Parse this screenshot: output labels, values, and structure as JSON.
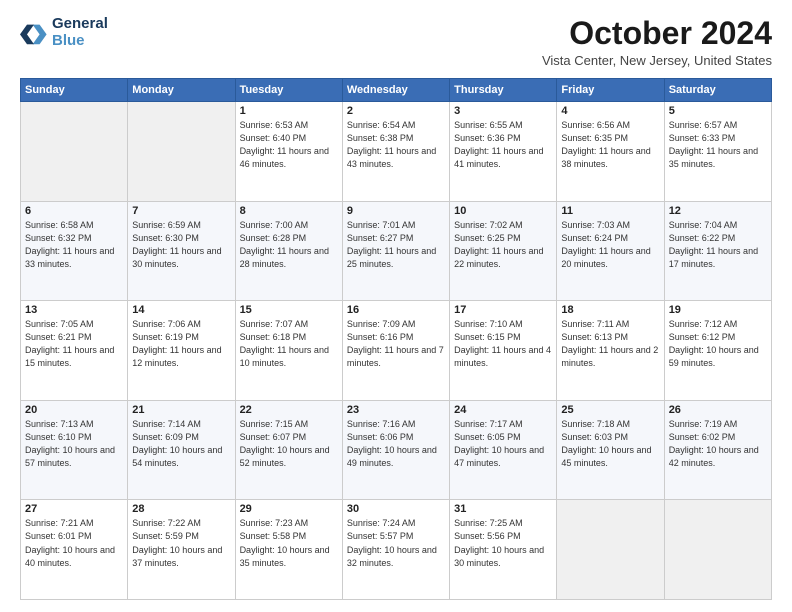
{
  "logo": {
    "line1": "General",
    "line2": "Blue"
  },
  "title": "October 2024",
  "location": "Vista Center, New Jersey, United States",
  "weekdays": [
    "Sunday",
    "Monday",
    "Tuesday",
    "Wednesday",
    "Thursday",
    "Friday",
    "Saturday"
  ],
  "weeks": [
    [
      {
        "day": "",
        "info": ""
      },
      {
        "day": "",
        "info": ""
      },
      {
        "day": "1",
        "info": "Sunrise: 6:53 AM\nSunset: 6:40 PM\nDaylight: 11 hours and 46 minutes."
      },
      {
        "day": "2",
        "info": "Sunrise: 6:54 AM\nSunset: 6:38 PM\nDaylight: 11 hours and 43 minutes."
      },
      {
        "day": "3",
        "info": "Sunrise: 6:55 AM\nSunset: 6:36 PM\nDaylight: 11 hours and 41 minutes."
      },
      {
        "day": "4",
        "info": "Sunrise: 6:56 AM\nSunset: 6:35 PM\nDaylight: 11 hours and 38 minutes."
      },
      {
        "day": "5",
        "info": "Sunrise: 6:57 AM\nSunset: 6:33 PM\nDaylight: 11 hours and 35 minutes."
      }
    ],
    [
      {
        "day": "6",
        "info": "Sunrise: 6:58 AM\nSunset: 6:32 PM\nDaylight: 11 hours and 33 minutes."
      },
      {
        "day": "7",
        "info": "Sunrise: 6:59 AM\nSunset: 6:30 PM\nDaylight: 11 hours and 30 minutes."
      },
      {
        "day": "8",
        "info": "Sunrise: 7:00 AM\nSunset: 6:28 PM\nDaylight: 11 hours and 28 minutes."
      },
      {
        "day": "9",
        "info": "Sunrise: 7:01 AM\nSunset: 6:27 PM\nDaylight: 11 hours and 25 minutes."
      },
      {
        "day": "10",
        "info": "Sunrise: 7:02 AM\nSunset: 6:25 PM\nDaylight: 11 hours and 22 minutes."
      },
      {
        "day": "11",
        "info": "Sunrise: 7:03 AM\nSunset: 6:24 PM\nDaylight: 11 hours and 20 minutes."
      },
      {
        "day": "12",
        "info": "Sunrise: 7:04 AM\nSunset: 6:22 PM\nDaylight: 11 hours and 17 minutes."
      }
    ],
    [
      {
        "day": "13",
        "info": "Sunrise: 7:05 AM\nSunset: 6:21 PM\nDaylight: 11 hours and 15 minutes."
      },
      {
        "day": "14",
        "info": "Sunrise: 7:06 AM\nSunset: 6:19 PM\nDaylight: 11 hours and 12 minutes."
      },
      {
        "day": "15",
        "info": "Sunrise: 7:07 AM\nSunset: 6:18 PM\nDaylight: 11 hours and 10 minutes."
      },
      {
        "day": "16",
        "info": "Sunrise: 7:09 AM\nSunset: 6:16 PM\nDaylight: 11 hours and 7 minutes."
      },
      {
        "day": "17",
        "info": "Sunrise: 7:10 AM\nSunset: 6:15 PM\nDaylight: 11 hours and 4 minutes."
      },
      {
        "day": "18",
        "info": "Sunrise: 7:11 AM\nSunset: 6:13 PM\nDaylight: 11 hours and 2 minutes."
      },
      {
        "day": "19",
        "info": "Sunrise: 7:12 AM\nSunset: 6:12 PM\nDaylight: 10 hours and 59 minutes."
      }
    ],
    [
      {
        "day": "20",
        "info": "Sunrise: 7:13 AM\nSunset: 6:10 PM\nDaylight: 10 hours and 57 minutes."
      },
      {
        "day": "21",
        "info": "Sunrise: 7:14 AM\nSunset: 6:09 PM\nDaylight: 10 hours and 54 minutes."
      },
      {
        "day": "22",
        "info": "Sunrise: 7:15 AM\nSunset: 6:07 PM\nDaylight: 10 hours and 52 minutes."
      },
      {
        "day": "23",
        "info": "Sunrise: 7:16 AM\nSunset: 6:06 PM\nDaylight: 10 hours and 49 minutes."
      },
      {
        "day": "24",
        "info": "Sunrise: 7:17 AM\nSunset: 6:05 PM\nDaylight: 10 hours and 47 minutes."
      },
      {
        "day": "25",
        "info": "Sunrise: 7:18 AM\nSunset: 6:03 PM\nDaylight: 10 hours and 45 minutes."
      },
      {
        "day": "26",
        "info": "Sunrise: 7:19 AM\nSunset: 6:02 PM\nDaylight: 10 hours and 42 minutes."
      }
    ],
    [
      {
        "day": "27",
        "info": "Sunrise: 7:21 AM\nSunset: 6:01 PM\nDaylight: 10 hours and 40 minutes."
      },
      {
        "day": "28",
        "info": "Sunrise: 7:22 AM\nSunset: 5:59 PM\nDaylight: 10 hours and 37 minutes."
      },
      {
        "day": "29",
        "info": "Sunrise: 7:23 AM\nSunset: 5:58 PM\nDaylight: 10 hours and 35 minutes."
      },
      {
        "day": "30",
        "info": "Sunrise: 7:24 AM\nSunset: 5:57 PM\nDaylight: 10 hours and 32 minutes."
      },
      {
        "day": "31",
        "info": "Sunrise: 7:25 AM\nSunset: 5:56 PM\nDaylight: 10 hours and 30 minutes."
      },
      {
        "day": "",
        "info": ""
      },
      {
        "day": "",
        "info": ""
      }
    ]
  ]
}
